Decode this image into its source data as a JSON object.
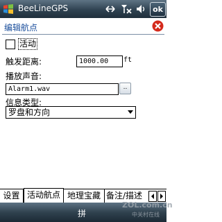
{
  "titlebar": {
    "app_title": "BeeLineGPS",
    "ok_label": "ok"
  },
  "dialog": {
    "title": "编辑航点"
  },
  "form": {
    "active_label": "活动",
    "active_checked": false,
    "distance_label": "触发距离:",
    "distance_value": "1000.00",
    "distance_unit": "ft",
    "sound_label": "播放声音:",
    "sound_value": "Alarm1.wav",
    "browse_label": "..",
    "info_label": "信息类型:",
    "info_value": "罗盘和方向"
  },
  "tabs": [
    {
      "label": "设置",
      "active": false
    },
    {
      "label": "活动航点",
      "active": true
    },
    {
      "label": "地理宝藏",
      "active": false
    },
    {
      "label": "备注/描述",
      "active": false
    }
  ],
  "softkey": {
    "ime_label": "拼"
  },
  "watermark": {
    "text": "ZOL.com.cn",
    "sub": "中关村在线"
  },
  "colors": {
    "titlebar": "#2f4251",
    "dialog_title": "#1b4f9c",
    "close_icon": "#d42a1c"
  }
}
